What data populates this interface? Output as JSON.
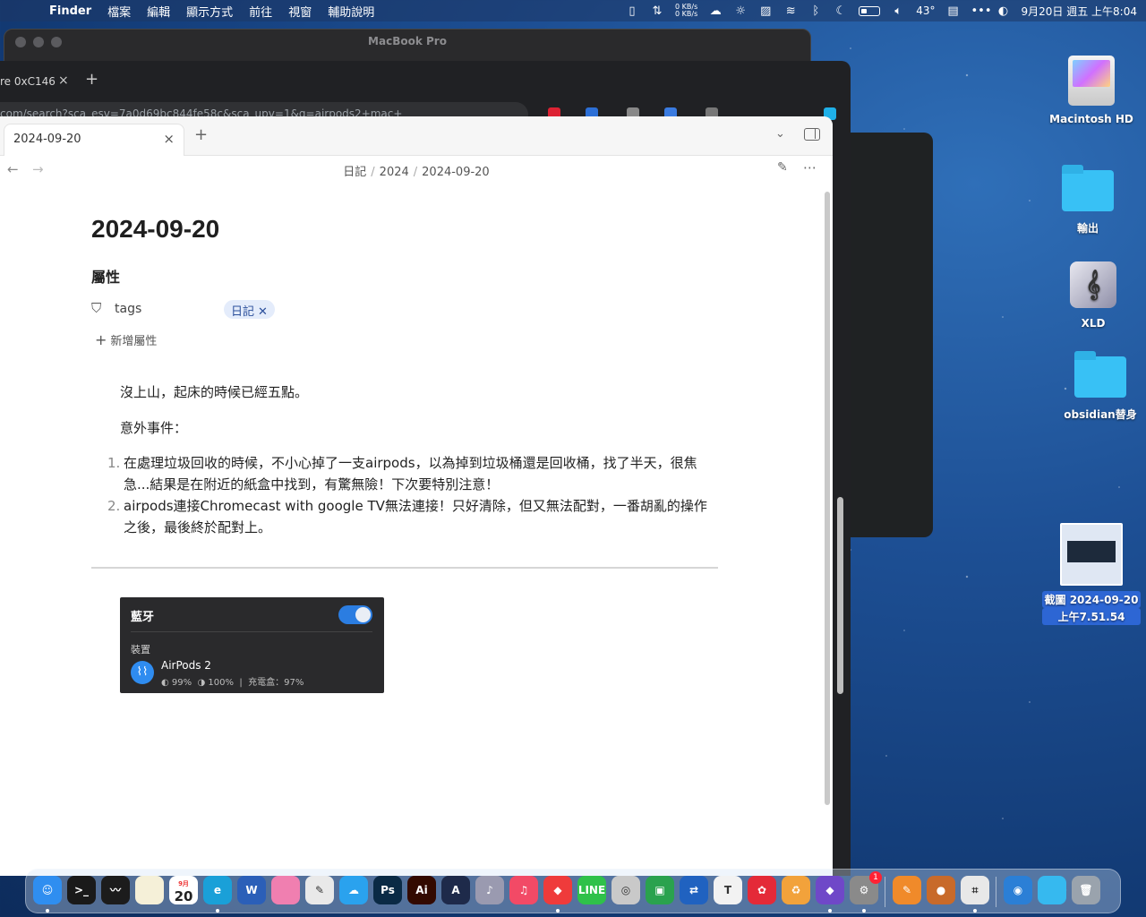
{
  "menubar": {
    "app": "Finder",
    "items": [
      "檔案",
      "編輯",
      "顯示方式",
      "前往",
      "視窗",
      "輔助說明"
    ],
    "net_up": "0 KB/s",
    "net_down": "0 KB/s",
    "temperature": "43°",
    "clock": "9月20日 週五 上午8:04"
  },
  "back_window": {
    "title": "MacBook Pro"
  },
  "browser": {
    "tab_label": "re 0xC146",
    "url": "com/search?sca_esv=7a0d69bc844fe58c&sca_upv=1&q=airpods2+mac+"
  },
  "obsidian": {
    "tab_title": "2024-09-20",
    "breadcrumb": [
      "日記",
      "2024",
      "2024-09-20"
    ],
    "note_title": "2024-09-20",
    "properties_heading": "屬性",
    "property": {
      "name": "tags",
      "value": "日記"
    },
    "add_property": "新增屬性",
    "paragraphs": [
      "沒上山，起床的時候已經五點。",
      "意外事件："
    ],
    "list": [
      {
        "num": "1.",
        "text": "在處理垃圾回收的時候，不小心掉了一支airpods，以為掉到垃圾桶還是回收桶，找了半天，很焦急...結果是在附近的紙盒中找到，有驚無險！下次要特別注意！"
      },
      {
        "num": "2.",
        "text": "airpods連接Chromecast with google TV無法連接！只好清除，但又無法配對，一番胡亂的操作之後，最後終於配對上。"
      }
    ],
    "embed": {
      "title": "藍牙",
      "section": "裝置",
      "device": "AirPods 2",
      "left": "99%",
      "right": "100%",
      "case_label": "充電盒：97%"
    }
  },
  "desktop": {
    "icons": [
      {
        "label": "Macintosh HD"
      },
      {
        "label": "輸出"
      },
      {
        "label": "XLD"
      },
      {
        "label": "obsidian替身"
      },
      {
        "label1": "截圖 2024-09-20",
        "label2": "上午7.51.54"
      }
    ]
  },
  "dock": {
    "calendar_day": "20",
    "calendar_month": "9月",
    "apps": [
      {
        "name": "finder",
        "color": "#2f8ef0",
        "glyph": "☺"
      },
      {
        "name": "terminal",
        "color": "#1a1a1a",
        "glyph": ">_"
      },
      {
        "name": "activity",
        "color": "#1c1c1c",
        "glyph": "〰"
      },
      {
        "name": "notes",
        "color": "#f5f0d8",
        "glyph": ""
      },
      {
        "name": "calendar",
        "color": "#ffffff",
        "glyph": ""
      },
      {
        "name": "edge",
        "color": "#1aa0d8",
        "glyph": "e"
      },
      {
        "name": "word",
        "color": "#2b5fb8",
        "glyph": "W"
      },
      {
        "name": "lightroom",
        "color": "#f07fb0",
        "glyph": ""
      },
      {
        "name": "script",
        "color": "#e9e9e9",
        "glyph": "✎"
      },
      {
        "name": "icloud",
        "color": "#2aa2ee",
        "glyph": "☁"
      },
      {
        "name": "photoshop",
        "color": "#0a2a45",
        "glyph": "Ps"
      },
      {
        "name": "illustrator",
        "color": "#330a00",
        "glyph": "Ai"
      },
      {
        "name": "affinity",
        "color": "#1e2a4a",
        "glyph": "A"
      },
      {
        "name": "xld",
        "color": "#9a9ab0",
        "glyph": "♪"
      },
      {
        "name": "music",
        "color": "#f24a66",
        "glyph": "♫"
      },
      {
        "name": "anydesk",
        "color": "#ef3b3b",
        "glyph": "◆"
      },
      {
        "name": "line",
        "color": "#2fc14a",
        "glyph": "LINE"
      },
      {
        "name": "dvd",
        "color": "#c9c9c9",
        "glyph": "◎"
      },
      {
        "name": "screens",
        "color": "#2aa24e",
        "glyph": "▣"
      },
      {
        "name": "remote",
        "color": "#2062c0",
        "glyph": "⇄"
      },
      {
        "name": "typora",
        "color": "#f2f2f2",
        "glyph": "T"
      },
      {
        "name": "flower",
        "color": "#e42a38",
        "glyph": "✿"
      },
      {
        "name": "recycle",
        "color": "#f2a23b",
        "glyph": "♻"
      },
      {
        "name": "obsidian",
        "color": "#6f48c8",
        "glyph": "◆"
      },
      {
        "name": "settings",
        "color": "#8a8a8a",
        "glyph": "⚙"
      },
      {
        "name": "pages",
        "color": "#f08a2a",
        "glyph": "✎"
      },
      {
        "name": "coffee",
        "color": "#c86a2a",
        "glyph": "●"
      },
      {
        "name": "preview",
        "color": "#e8e8e8",
        "glyph": "⌗"
      }
    ]
  }
}
